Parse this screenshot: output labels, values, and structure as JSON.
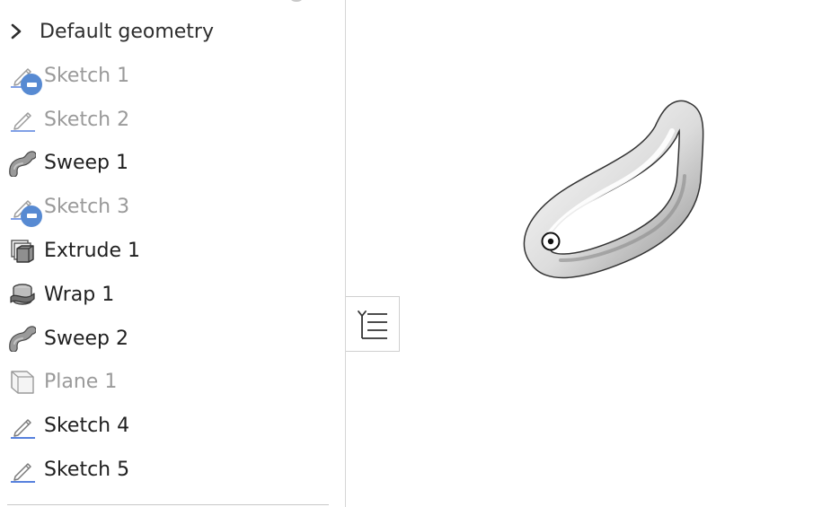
{
  "tree": {
    "header_label": "Default geometry",
    "items": [
      {
        "label": "Sketch 1",
        "icon": "sketch-icon",
        "muted": true,
        "suppressed": true
      },
      {
        "label": "Sketch 2",
        "icon": "sketch-icon",
        "muted": true,
        "suppressed": false
      },
      {
        "label": "Sweep 1",
        "icon": "sweep-icon",
        "muted": false,
        "suppressed": false
      },
      {
        "label": "Sketch 3",
        "icon": "sketch-icon",
        "muted": true,
        "suppressed": true
      },
      {
        "label": "Extrude 1",
        "icon": "extrude-icon",
        "muted": false,
        "suppressed": false
      },
      {
        "label": "Wrap 1",
        "icon": "wrap-icon",
        "muted": false,
        "suppressed": false
      },
      {
        "label": "Sweep 2",
        "icon": "sweep-icon",
        "muted": false,
        "suppressed": false
      },
      {
        "label": "Plane 1",
        "icon": "plane-icon",
        "muted": true,
        "suppressed": false
      },
      {
        "label": "Sketch 4",
        "icon": "sketch-icon",
        "muted": false,
        "suppressed": false
      },
      {
        "label": "Sketch 5",
        "icon": "sketch-icon",
        "muted": false,
        "suppressed": false
      }
    ]
  },
  "colors": {
    "suppressed_badge": "#1f63c4",
    "muted_text": "#9a9a9a",
    "normal_text": "#1f1f1f",
    "sketch_line": "#3f6fd8"
  },
  "toggle": {
    "icon": "feature-list-toggle-icon"
  },
  "viewport": {
    "model": "teardrop-loop-sweep",
    "origin_marker": "origin-icon"
  }
}
